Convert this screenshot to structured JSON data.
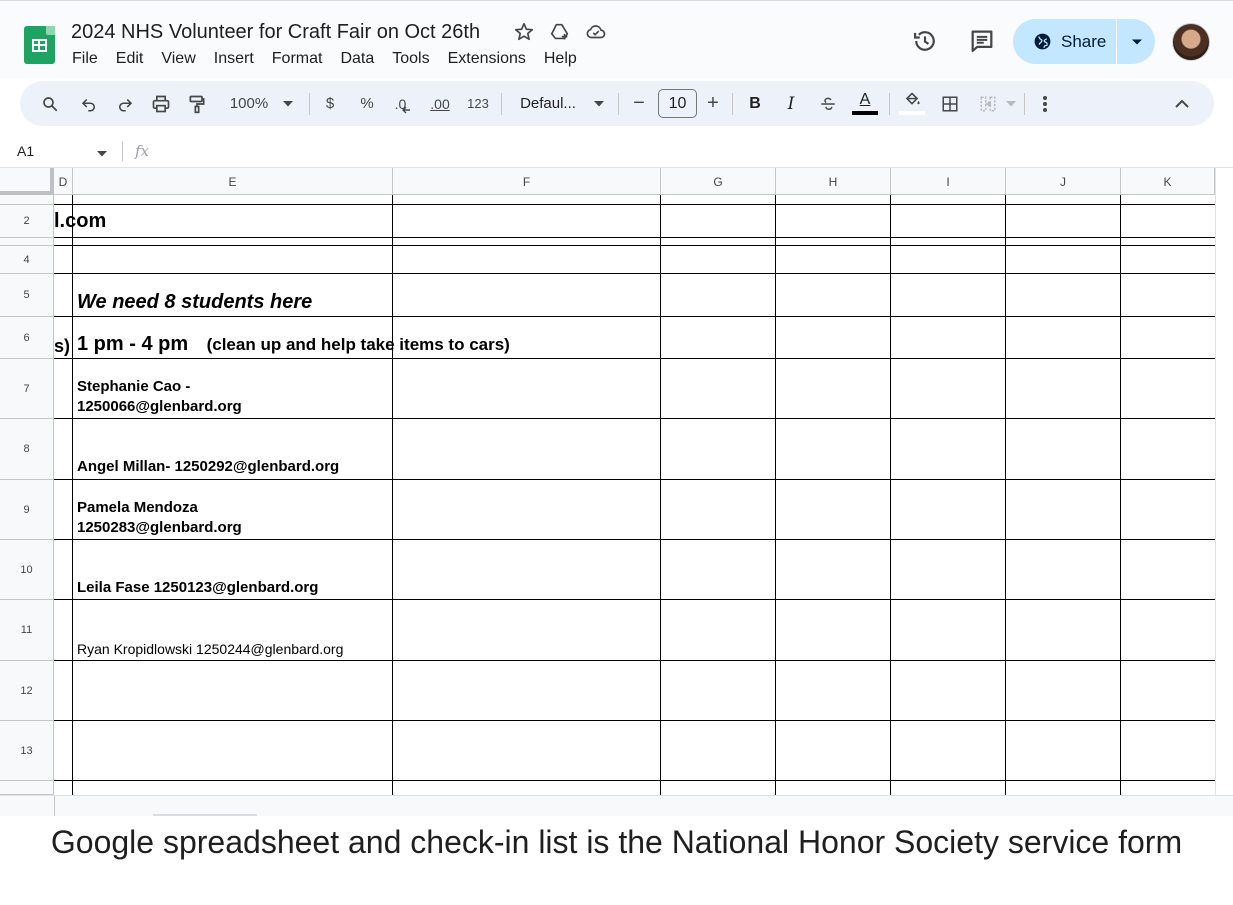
{
  "app": {
    "doc_title": "2024 NHS Volunteer for Craft Fair on Oct 26th",
    "menu": [
      "File",
      "Edit",
      "View",
      "Insert",
      "Format",
      "Data",
      "Tools",
      "Extensions",
      "Help"
    ],
    "share_label": "Share",
    "brand_color": "#1ea362",
    "share_color": "#c2e7ff"
  },
  "toolbar": {
    "zoom": "100%",
    "currency": "$",
    "percent": "%",
    "dec_decrease": ".0",
    "dec_increase": ".00",
    "number_format": "123",
    "font": "Defaul...",
    "font_size": "10",
    "minus": "−",
    "plus": "+",
    "bold": "B",
    "italic": "I",
    "text_color_letter": "A"
  },
  "formula_bar": {
    "cell_ref": "A1",
    "fx": "fx",
    "value": ""
  },
  "grid": {
    "columns": [
      "D",
      "E",
      "F",
      "G",
      "H",
      "I",
      "J",
      "K"
    ],
    "rows": [
      "2",
      "4",
      "5",
      "6",
      "7",
      "8",
      "9",
      "10",
      "11",
      "12",
      "13"
    ],
    "cells": {
      "r2_d": "l.com",
      "r5_e": "We need 8 students here",
      "r6_d": "s)",
      "r6_e_time": "1 pm - 4 pm",
      "r6_e_note": "(clean up and help take items to cars)",
      "r7_e_line1": "Stephanie Cao -",
      "r7_e_line2": "1250066@glenbard.org",
      "r8_e": "Angel Millan- 1250292@glenbard.org",
      "r9_e_line1": "Pamela Mendoza",
      "r9_e_line2": "1250283@glenbard.org",
      "r10_e": "Leila Fase 1250123@glenbard.org",
      "r11_e": "Ryan Kropidlowski 1250244@glenbard.org"
    }
  },
  "caption": "Google spreadsheet and check-in list is the National Honor Society service form"
}
